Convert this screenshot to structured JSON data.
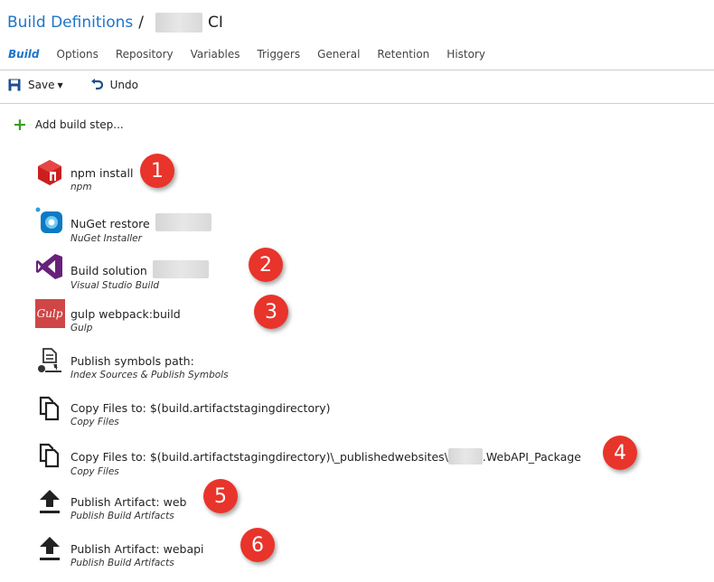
{
  "breadcrumb": {
    "root": "Build Definitions",
    "separator": "/",
    "current": "CI"
  },
  "tabs": [
    {
      "label": "Build",
      "active": true
    },
    {
      "label": "Options"
    },
    {
      "label": "Repository"
    },
    {
      "label": "Variables"
    },
    {
      "label": "Triggers"
    },
    {
      "label": "General"
    },
    {
      "label": "Retention"
    },
    {
      "label": "History"
    }
  ],
  "toolbar": {
    "save_label": "Save",
    "undo_label": "Undo"
  },
  "add_step_label": "Add build step...",
  "steps": [
    {
      "title": "npm install",
      "subtitle": "npm",
      "icon": "npm-icon",
      "badge": "1"
    },
    {
      "title": "NuGet restore",
      "subtitle": "NuGet Installer",
      "icon": "nuget-icon"
    },
    {
      "title": "Build solution",
      "subtitle": "Visual Studio Build",
      "icon": "visual-studio-icon",
      "badge": "2"
    },
    {
      "title": "gulp webpack:build",
      "subtitle": "Gulp",
      "icon": "gulp-icon",
      "badge": "3",
      "icon_text": "Gulp"
    },
    {
      "title": "Publish symbols path:",
      "subtitle": "Index Sources & Publish Symbols",
      "icon": "publish-symbols-icon"
    },
    {
      "title": "Copy Files to: $(build.artifactstagingdirectory)",
      "subtitle": "Copy Files",
      "icon": "copy-files-icon"
    },
    {
      "title_prefix": "Copy Files to: $(build.artifactstagingdirectory)\\_publishedwebsites\\",
      "title_suffix": ".WebAPI_Package",
      "subtitle": "Copy Files",
      "icon": "copy-files-icon",
      "badge": "4"
    },
    {
      "title": "Publish Artifact: web",
      "subtitle": "Publish Build Artifacts",
      "icon": "upload-icon",
      "badge": "5"
    },
    {
      "title": "Publish Artifact: webapi",
      "subtitle": "Publish Build Artifacts",
      "icon": "upload-icon",
      "badge": "6"
    }
  ],
  "colors": {
    "link": "#1e74c8",
    "badge": "#e8342b",
    "add": "#3a9d23"
  }
}
